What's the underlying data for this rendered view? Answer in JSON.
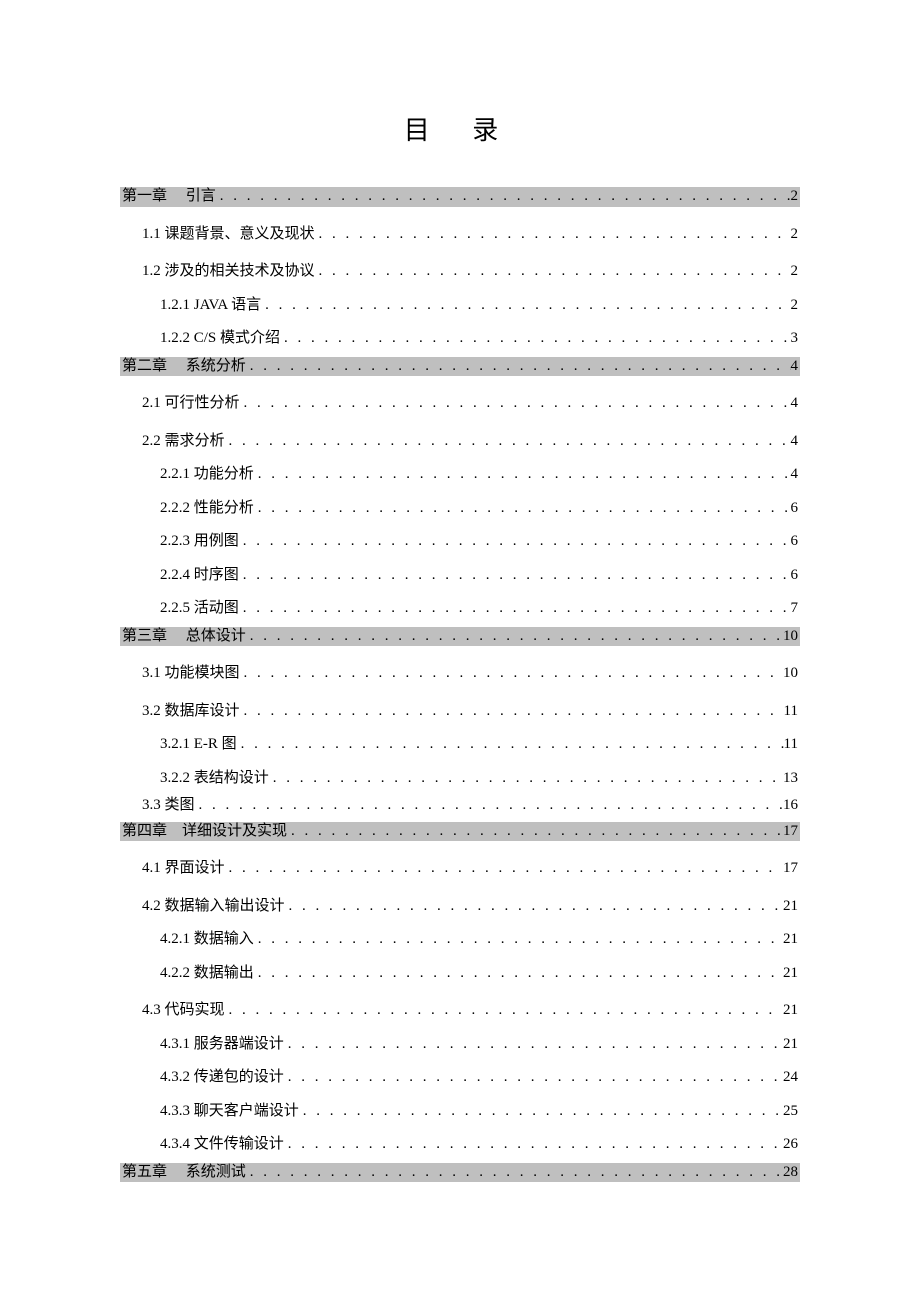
{
  "title": "目 录",
  "dot_fill": ". . . . . . . . . . . . . . . . . . . . . . . . . . . . . . . . . . . . . . . . . . . . . . . . . . . . . . . . . . . . . . . . . . . . . . . . . . . . . . . . . . . . . . . . . . . . . . . . . . . . . . . . . . . . . . . . . .",
  "toc": [
    {
      "level": "chapter",
      "label": "第一章　 引言",
      "page": "2"
    },
    {
      "level": "section",
      "label": "1.1 课题背景、意义及现状",
      "page": "2"
    },
    {
      "level": "section",
      "label": "1.2 涉及的相关技术及协议",
      "page": "2"
    },
    {
      "level": "subsection",
      "label": "1.2.1 JAVA 语言",
      "page": "2"
    },
    {
      "level": "subsection",
      "label": "1.2.2 C/S 模式介绍",
      "page": "3"
    },
    {
      "level": "chapter",
      "label": "第二章　 系统分析",
      "page": "4"
    },
    {
      "level": "section",
      "label": "2.1 可行性分析",
      "page": "4"
    },
    {
      "level": "section",
      "label": "2.2 需求分析",
      "page": "4"
    },
    {
      "level": "subsection",
      "label": "2.2.1 功能分析",
      "page": "4"
    },
    {
      "level": "subsection",
      "label": "2.2.2 性能分析",
      "page": "6"
    },
    {
      "level": "subsection",
      "label": "2.2.3 用例图",
      "page": "6"
    },
    {
      "level": "subsection",
      "label": "2.2.4 时序图",
      "page": "6"
    },
    {
      "level": "subsection",
      "label": "2.2.5 活动图",
      "page": "7"
    },
    {
      "level": "chapter",
      "label": "第三章　 总体设计",
      "page": "10"
    },
    {
      "level": "section",
      "label": "3.1 功能模块图",
      "page": "10"
    },
    {
      "level": "section",
      "label": "3.2 数据库设计",
      "page": "11"
    },
    {
      "level": "subsection",
      "label": "3.2.1 E-R 图",
      "page": "11"
    },
    {
      "level": "subsection",
      "label": "3.2.2 表结构设计",
      "page": "13"
    },
    {
      "level": "section",
      "label": "3.3 类图",
      "page": "16"
    },
    {
      "level": "chapter",
      "label": "第四章　详细设计及实现",
      "page": "17"
    },
    {
      "level": "section",
      "label": "4.1 界面设计",
      "page": "17"
    },
    {
      "level": "section",
      "label": "4.2 数据输入输出设计",
      "page": "21"
    },
    {
      "level": "subsection",
      "label": "4.2.1 数据输入",
      "page": "21"
    },
    {
      "level": "subsection",
      "label": "4.2.2 数据输出",
      "page": "21"
    },
    {
      "level": "section",
      "label": "4.3 代码实现",
      "page": "21"
    },
    {
      "level": "subsection",
      "label": "4.3.1 服务器端设计",
      "page": "21"
    },
    {
      "level": "subsection",
      "label": "4.3.2 传递包的设计",
      "page": "24"
    },
    {
      "level": "subsection",
      "label": "4.3.3 聊天客户端设计",
      "page": "25"
    },
    {
      "level": "subsection",
      "label": "4.3.4 文件传输设计",
      "page": "26"
    },
    {
      "level": "chapter",
      "label": "第五章　 系统测试",
      "page": "28"
    }
  ]
}
